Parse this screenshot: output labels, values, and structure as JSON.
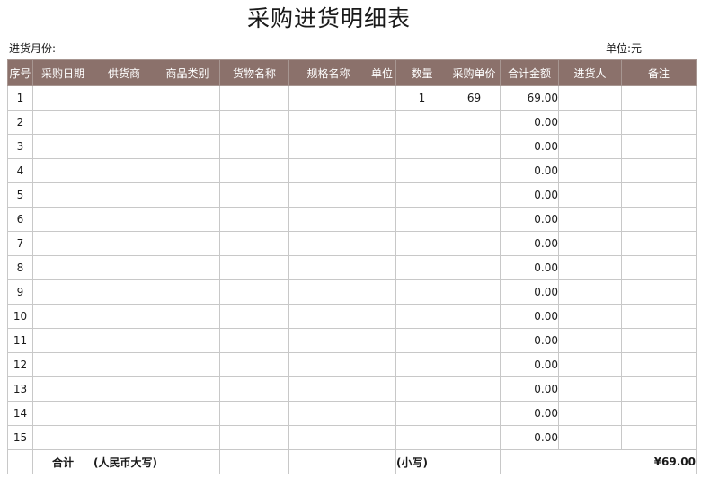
{
  "title": "采购进货明细表",
  "month_label": "进货月份:",
  "unit_label": "单位:元",
  "headers": [
    "序号",
    "采购日期",
    "供货商",
    "商品类别",
    "货物名称",
    "规格名称",
    "单位",
    "数量",
    "采购单价",
    "合计金额",
    "进货人",
    "备注"
  ],
  "rows": [
    {
      "no": "1",
      "qty": "1",
      "price": "69",
      "amount": "69.00"
    },
    {
      "no": "2",
      "qty": "",
      "price": "",
      "amount": "0.00"
    },
    {
      "no": "3",
      "qty": "",
      "price": "",
      "amount": "0.00"
    },
    {
      "no": "4",
      "qty": "",
      "price": "",
      "amount": "0.00"
    },
    {
      "no": "5",
      "qty": "",
      "price": "",
      "amount": "0.00"
    },
    {
      "no": "6",
      "qty": "",
      "price": "",
      "amount": "0.00"
    },
    {
      "no": "7",
      "qty": "",
      "price": "",
      "amount": "0.00"
    },
    {
      "no": "8",
      "qty": "",
      "price": "",
      "amount": "0.00"
    },
    {
      "no": "9",
      "qty": "",
      "price": "",
      "amount": "0.00"
    },
    {
      "no": "10",
      "qty": "",
      "price": "",
      "amount": "0.00"
    },
    {
      "no": "11",
      "qty": "",
      "price": "",
      "amount": "0.00"
    },
    {
      "no": "12",
      "qty": "",
      "price": "",
      "amount": "0.00"
    },
    {
      "no": "13",
      "qty": "",
      "price": "",
      "amount": "0.00"
    },
    {
      "no": "14",
      "qty": "",
      "price": "",
      "amount": "0.00"
    },
    {
      "no": "15",
      "qty": "",
      "price": "",
      "amount": "0.00"
    }
  ],
  "total": {
    "label": "合计",
    "uppercase_label": "(人民币大写)",
    "lowercase_label": "(小写)",
    "amount": "¥69.00"
  }
}
